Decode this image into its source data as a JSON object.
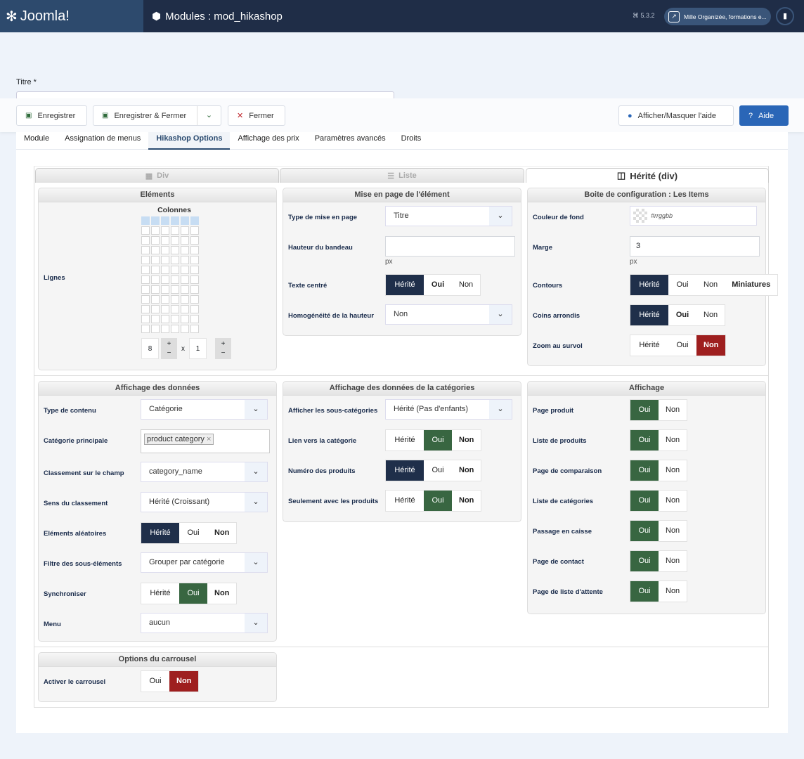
{
  "header": {
    "logo": "Joomla!",
    "title": "Modules : mod_hikashop",
    "version": "5.3.2",
    "site": "Mille Organizée, formations e..."
  },
  "title_label": "Titre *",
  "toolbar": {
    "save": "Enregistrer",
    "save_close": "Enregistrer & Fermer",
    "close": "Fermer",
    "toggle_help": "Afficher/Masquer l'aide",
    "help": "Aide"
  },
  "tabs": [
    "Module",
    "Assignation de menus",
    "Hikashop Options",
    "Affichage des prix",
    "Paramètres avancés",
    "Droits"
  ],
  "active_tab": 2,
  "layout_tabs": [
    "Div",
    "Liste",
    "Hérité (div)"
  ],
  "colors": {
    "dark": "#1f2f4a",
    "green": "#386641",
    "red": "#9e1f1f"
  },
  "elements": {
    "title": "Eléments",
    "columns_label": "Colonnes",
    "rows_label": "Lignes",
    "rows_value": "8",
    "cols_value": "1",
    "x": "x",
    "grid_columns": 6,
    "grid_rows": 12
  },
  "panels": [
    {
      "id": "p-layout",
      "title": "Mise en page de l'élément",
      "rows": [
        {
          "label": "Type de mise en page",
          "type": "select",
          "value": "Titre"
        },
        {
          "label": "Hauteur du bandeau",
          "type": "input",
          "value": "",
          "suffix": "px"
        },
        {
          "label": "Texte centré",
          "type": "toggle",
          "options": [
            "Hérité",
            "Oui",
            "Non"
          ],
          "active": 0,
          "bold": [
            1
          ],
          "color": "dark"
        },
        {
          "label": "Homogénéité de la hauteur",
          "type": "select",
          "value": "Non"
        }
      ]
    },
    {
      "id": "p-box",
      "title": "Boite de configuration : Les Items",
      "rows": [
        {
          "label": "Couleur de fond",
          "type": "color",
          "value": "#rrggbb"
        },
        {
          "label": "Marge",
          "type": "input",
          "value": "3",
          "suffix": "px"
        },
        {
          "label": "Contours",
          "type": "toggle",
          "options": [
            "Hérité",
            "Oui",
            "Non",
            "Miniatures"
          ],
          "active": 0,
          "bold": [
            3
          ],
          "color": "dark"
        },
        {
          "label": "Coins arrondis",
          "type": "toggle",
          "options": [
            "Hérité",
            "Oui",
            "Non"
          ],
          "active": 0,
          "bold": [
            1
          ],
          "color": "dark"
        },
        {
          "label": "Zoom au survol",
          "type": "toggle",
          "options": [
            "Hérité",
            "Oui",
            "Non"
          ],
          "active": 2,
          "bold": [],
          "color": "red"
        }
      ]
    },
    {
      "id": "p-data",
      "title": "Affichage des données",
      "rows": [
        {
          "label": "Type de contenu",
          "type": "select",
          "value": "Catégorie"
        },
        {
          "label": "Catégorie principale",
          "type": "tags",
          "value": "product category"
        },
        {
          "label": "Classement sur le champ",
          "type": "select",
          "value": "category_name"
        },
        {
          "label": "Sens du classement",
          "type": "select",
          "value": "Hérité (Croissant)"
        },
        {
          "label": "Eléments aléatoires",
          "type": "toggle",
          "options": [
            "Hérité",
            "Oui",
            "Non"
          ],
          "active": 0,
          "bold": [
            2
          ],
          "color": "dark"
        },
        {
          "label": "Filtre des sous-éléments",
          "type": "select",
          "value": "Grouper par catégorie"
        },
        {
          "label": "Synchroniser",
          "type": "toggle",
          "options": [
            "Hérité",
            "Oui",
            "Non"
          ],
          "active": 1,
          "bold": [
            2
          ],
          "color": "green"
        },
        {
          "label": "Menu",
          "type": "select",
          "value": "aucun"
        }
      ]
    },
    {
      "id": "p-cat",
      "title": "Affichage des données de la catégories",
      "rows": [
        {
          "label": "Afficher les sous-catégories",
          "type": "select",
          "value": "Hérité (Pas d'enfants)"
        },
        {
          "label": "Lien vers la catégorie",
          "type": "toggle",
          "options": [
            "Hérité",
            "Oui",
            "Non"
          ],
          "active": 1,
          "bold": [
            2
          ],
          "color": "green"
        },
        {
          "label": "Numéro des produits",
          "type": "toggle",
          "options": [
            "Hérité",
            "Oui",
            "Non"
          ],
          "active": 0,
          "bold": [
            2
          ],
          "color": "dark"
        },
        {
          "label": "Seulement avec les produits",
          "type": "toggle",
          "options": [
            "Hérité",
            "Oui",
            "Non"
          ],
          "active": 1,
          "bold": [
            2
          ],
          "color": "green"
        }
      ]
    },
    {
      "id": "p-disp",
      "title": "Affichage",
      "rows": [
        {
          "label": "Page produit",
          "type": "toggle",
          "options": [
            "Oui",
            "Non"
          ],
          "active": 0,
          "bold": [],
          "color": "green"
        },
        {
          "label": "Liste de produits",
          "type": "toggle",
          "options": [
            "Oui",
            "Non"
          ],
          "active": 0,
          "bold": [],
          "color": "green"
        },
        {
          "label": "Page de comparaison",
          "type": "toggle",
          "options": [
            "Oui",
            "Non"
          ],
          "active": 0,
          "bold": [],
          "color": "green"
        },
        {
          "label": "Liste de catégories",
          "type": "toggle",
          "options": [
            "Oui",
            "Non"
          ],
          "active": 0,
          "bold": [],
          "color": "green"
        },
        {
          "label": "Passage en caisse",
          "type": "toggle",
          "options": [
            "Oui",
            "Non"
          ],
          "active": 0,
          "bold": [],
          "color": "green"
        },
        {
          "label": "Page de contact",
          "type": "toggle",
          "options": [
            "Oui",
            "Non"
          ],
          "active": 0,
          "bold": [],
          "color": "green"
        },
        {
          "label": "Page de liste d'attente",
          "type": "toggle",
          "options": [
            "Oui",
            "Non"
          ],
          "active": 0,
          "bold": [],
          "color": "green"
        }
      ]
    },
    {
      "id": "p-car",
      "title": "Options du carrousel",
      "rows": [
        {
          "label": "Activer le carrousel",
          "type": "toggle",
          "options": [
            "Oui",
            "Non"
          ],
          "active": 1,
          "bold": [],
          "color": "red"
        }
      ]
    }
  ]
}
